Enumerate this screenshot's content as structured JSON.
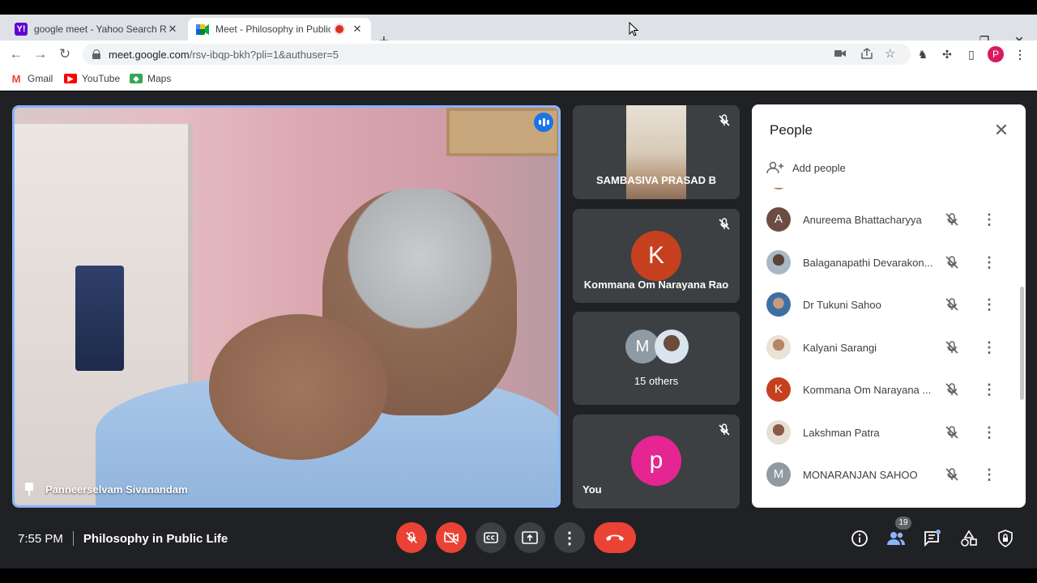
{
  "browser": {
    "tabs": [
      {
        "title": "google meet - Yahoo Search Res",
        "favicon": "Y!",
        "favicon_color": "#6001d2"
      },
      {
        "title": "Meet - Philosophy in Public",
        "favicon": "meet",
        "recording": true
      }
    ],
    "url_host": "meet.google.com",
    "url_path": "/rsv-ibqp-bkh?pli=1&authuser=5",
    "profile_initial": "P",
    "bookmarks": [
      {
        "label": "Gmail",
        "color": "#ea4335"
      },
      {
        "label": "YouTube",
        "color": "#ff0000"
      },
      {
        "label": "Maps",
        "color": "#34a853"
      }
    ]
  },
  "meet": {
    "main_speaker": {
      "name": "Panneerselvam Sivanandam",
      "speaking": true,
      "pinned": true
    },
    "side_tiles": [
      {
        "name": "SAMBASIVA PRASAD B",
        "muted": true,
        "has_video": true
      },
      {
        "name": "Kommana Om Narayana Rao",
        "initial": "K",
        "color": "#c5401f",
        "muted": true
      },
      {
        "name": "15 others",
        "initials": [
          "M"
        ],
        "color": "#8e9ba4"
      },
      {
        "name": "You",
        "initial": "p",
        "color": "#e52592",
        "muted": true
      }
    ],
    "people_panel": {
      "title": "People",
      "add_label": "Add people",
      "participants": [
        {
          "name": "Anureema Bhattacharyya",
          "initial": "A",
          "color": "#6d4c41",
          "muted": true
        },
        {
          "name": "Balaganapathi Devarakon...",
          "initial": "",
          "color": "#7a8a99",
          "photo": true,
          "muted": true
        },
        {
          "name": "Dr Tukuni Sahoo",
          "initial": "",
          "color": "#5a7fa8",
          "photo": true,
          "muted": true
        },
        {
          "name": "Kalyani Sarangi",
          "initial": "",
          "color": "#c09070",
          "photo": true,
          "muted": true
        },
        {
          "name": "Kommana Om Narayana ...",
          "initial": "K",
          "color": "#c5401f",
          "muted": true
        },
        {
          "name": "Lakshman Patra",
          "initial": "",
          "color": "#9e6a5a",
          "photo": true,
          "muted": true
        },
        {
          "name": "MONARANJAN SAHOO",
          "initial": "M",
          "color": "#8e9ba4",
          "muted": true
        }
      ]
    },
    "bottom": {
      "time": "7:55 PM",
      "meeting_title": "Philosophy in Public Life",
      "participant_count": "19"
    }
  }
}
